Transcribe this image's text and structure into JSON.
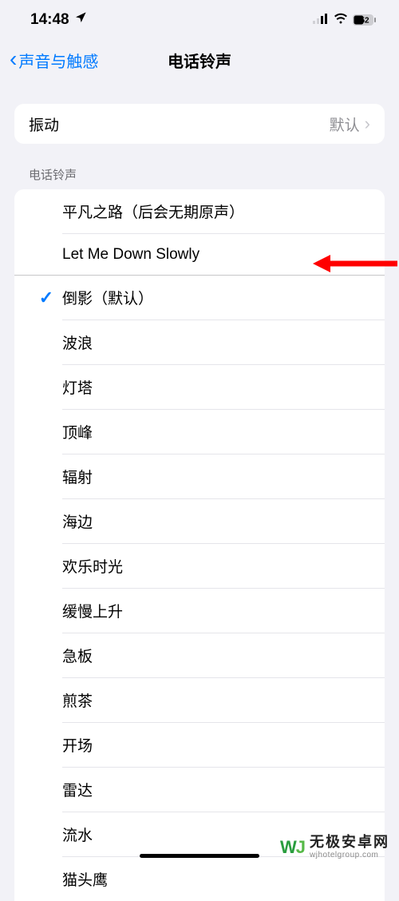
{
  "statusBar": {
    "time": "14:48",
    "battery": "52"
  },
  "nav": {
    "back": "声音与触感",
    "title": "电话铃声"
  },
  "vibration": {
    "label": "振动",
    "value": "默认"
  },
  "sectionHeader": "电话铃声",
  "customTones": [
    {
      "label": "平凡之路（后会无期原声）",
      "selected": false
    },
    {
      "label": "Let Me Down Slowly",
      "selected": false
    }
  ],
  "systemTones": [
    {
      "label": "倒影（默认）",
      "selected": true
    },
    {
      "label": "波浪",
      "selected": false
    },
    {
      "label": "灯塔",
      "selected": false
    },
    {
      "label": "顶峰",
      "selected": false
    },
    {
      "label": "辐射",
      "selected": false
    },
    {
      "label": "海边",
      "selected": false
    },
    {
      "label": "欢乐时光",
      "selected": false
    },
    {
      "label": "缓慢上升",
      "selected": false
    },
    {
      "label": "急板",
      "selected": false
    },
    {
      "label": "煎茶",
      "selected": false
    },
    {
      "label": "开场",
      "selected": false
    },
    {
      "label": "雷达",
      "selected": false
    },
    {
      "label": "流水",
      "selected": false
    },
    {
      "label": "猫头鹰",
      "selected": false
    }
  ],
  "watermark": {
    "cn": "无极安卓网",
    "en": "wjhotelgroup.com"
  }
}
